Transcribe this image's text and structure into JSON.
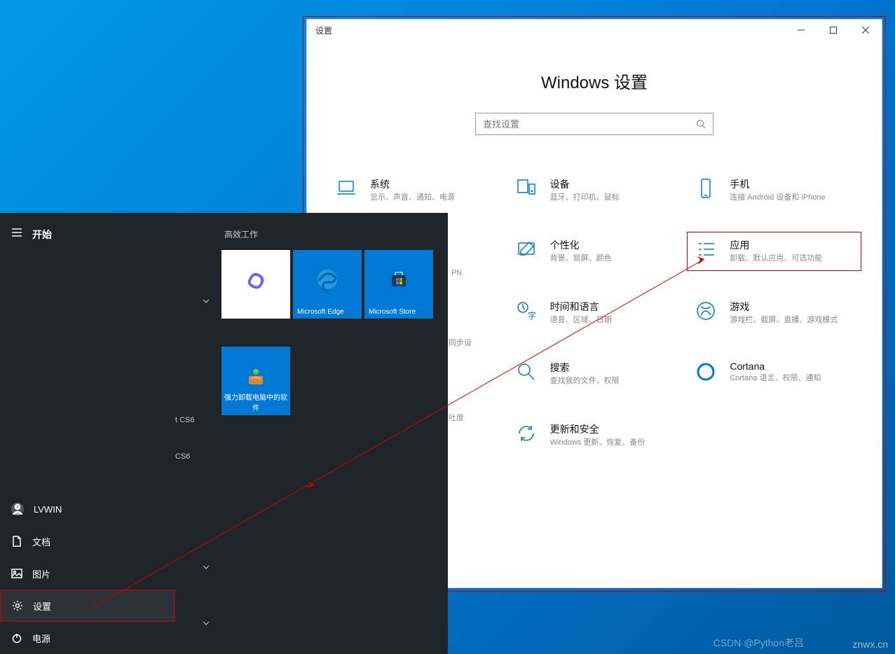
{
  "settings": {
    "window_title": "设置",
    "heading": "Windows 设置",
    "search_placeholder": "查找设置",
    "partial_text_vpn": "PN",
    "partial_text_sync": "同步设",
    "partial_text_contrast": "吐度",
    "items": [
      {
        "title": "系统",
        "desc": "显示、声音、通知、电源"
      },
      {
        "title": "设备",
        "desc": "蓝牙、打印机、鼠标"
      },
      {
        "title": "手机",
        "desc": "连接 Android 设备和 iPhone"
      },
      {
        "title": "个性化",
        "desc": "背景、锁屏、颜色"
      },
      {
        "title": "应用",
        "desc": "卸载、默认应用、可选功能"
      },
      {
        "title": "时间和语言",
        "desc": "语音、区域、日期"
      },
      {
        "title": "游戏",
        "desc": "游戏栏、截屏、直播、游戏模式"
      },
      {
        "title": "搜索",
        "desc": "查找我的文件、权限"
      },
      {
        "title": "Cortana",
        "desc": "Cortana 语言、权限、通知"
      },
      {
        "title": "更新和安全",
        "desc": "Windows 更新、恢复、备份"
      }
    ]
  },
  "start_menu": {
    "title": "开始",
    "user": "LVWIN",
    "items": {
      "documents": "文档",
      "pictures": "图片",
      "settings": "设置",
      "power": "电源"
    },
    "apps_partial": [
      "t CS6",
      "CS6"
    ],
    "tiles_section": "高效工作",
    "tiles": [
      {
        "label": "",
        "bg": "white"
      },
      {
        "label": "Microsoft Edge",
        "bg": "blue"
      },
      {
        "label": "Microsoft Store",
        "bg": "blue"
      },
      {
        "label": "强力卸载电脑中的软件",
        "bg": "blue"
      }
    ]
  },
  "watermark": {
    "right": "znwx.cn",
    "center": "CSDN @Python老吕"
  }
}
